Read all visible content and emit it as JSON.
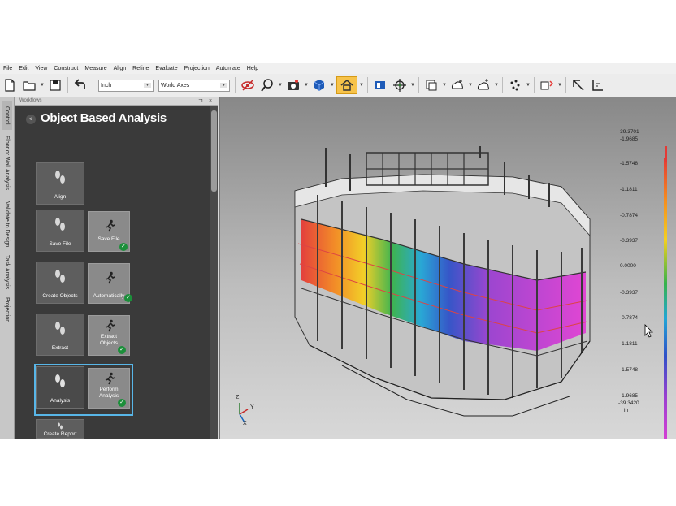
{
  "menu": [
    "File",
    "Edit",
    "View",
    "Construct",
    "Measure",
    "Align",
    "Refine",
    "Evaluate",
    "Projection",
    "Automate",
    "Help"
  ],
  "toolbar": {
    "units_value": "Inch",
    "coord_system_value": "World Axes",
    "icons": [
      "new-file-icon",
      "open-folder-icon",
      "save-icon",
      "undo-icon",
      "visibility-icon",
      "zoom-icon",
      "camera-icon",
      "cube-view-icon",
      "home-view-icon",
      "panel-icon",
      "target-icon",
      "layer-icon",
      "point-cloud-icon",
      "mesh-icon",
      "scatter-icon",
      "dimension-icon",
      "plane-icon",
      "fl-icon"
    ]
  },
  "side_tabs": [
    "Control",
    "Floor or Wall Analysis",
    "Validate to Design",
    "Task Analysis",
    "Projection"
  ],
  "workflows": {
    "panel_title": "Workflows",
    "heading": "Object Based Analysis",
    "steps": [
      {
        "label": "Align",
        "action": null
      },
      {
        "label": "Save File",
        "action": "Save File"
      },
      {
        "label": "Create Objects",
        "action": "Automatically"
      },
      {
        "label": "Extract",
        "action": "Extract Objects"
      },
      {
        "label": "Analysis",
        "action": "Perform Analysis",
        "selected": true
      },
      {
        "label": "Create Report",
        "action": null
      }
    ]
  },
  "legend": {
    "values": [
      "-39.3701",
      "-1.9685",
      "-1.5748",
      "-1.1811",
      "-0.7874",
      "-0.3937",
      "0.0000",
      "-0.3937",
      "-0.7874",
      "-1.1811",
      "-1.5748",
      "-1.9685",
      "-39.3420"
    ],
    "unit": "in",
    "colors": [
      "#e53935",
      "#f58b1f",
      "#f4d020",
      "#37b34a",
      "#21a6d6",
      "#2f50c8",
      "#9a3fd0",
      "#e23fd4"
    ]
  },
  "axes": {
    "z": "Z",
    "y": "Y",
    "x": "X"
  }
}
